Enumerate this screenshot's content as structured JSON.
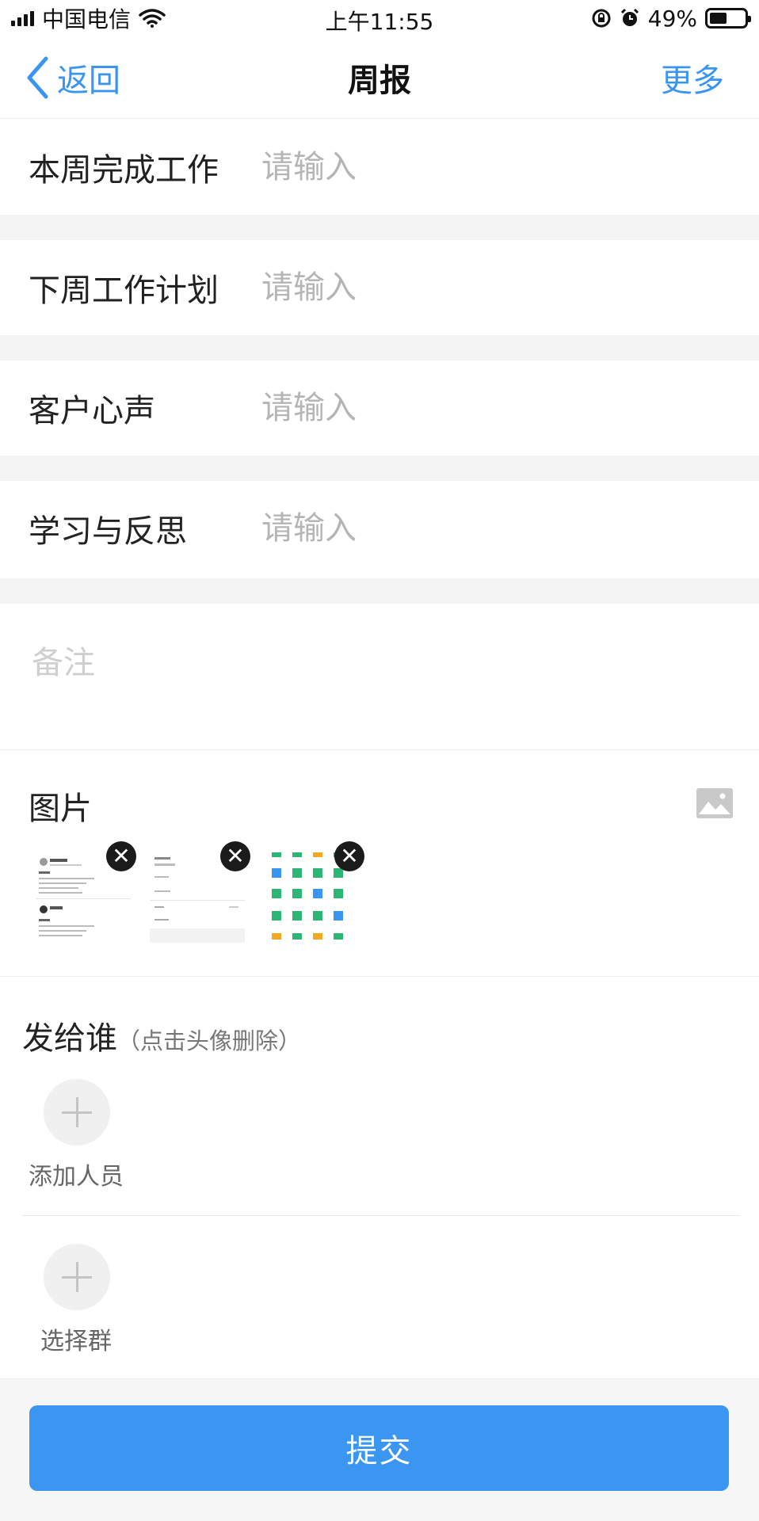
{
  "status_bar": {
    "carrier": "中国电信",
    "time": "上午11:55",
    "battery_percent": "49%",
    "battery_level": 0.49
  },
  "nav": {
    "back_label": "返回",
    "title": "周报",
    "more_label": "更多"
  },
  "form": {
    "rows": [
      {
        "label": "本周完成工作",
        "placeholder": "请输入"
      },
      {
        "label": "下周工作计划",
        "placeholder": "请输入"
      },
      {
        "label": "客户心声",
        "placeholder": "请输入"
      },
      {
        "label": "学习与反思",
        "placeholder": "请输入"
      }
    ],
    "remarks_placeholder": "备注"
  },
  "pictures": {
    "title": "图片",
    "thumbnails": [
      {
        "kind": "chat-screenshot"
      },
      {
        "kind": "form-screenshot"
      },
      {
        "kind": "icon-grid-screenshot"
      }
    ]
  },
  "send_to": {
    "title": "发给谁",
    "hint": "（点击头像删除）",
    "add_person_label": "添加人员",
    "select_group_label": "选择群"
  },
  "submit_label": "提交",
  "colors": {
    "accent": "#3a95f0",
    "submit": "#3a96f1",
    "placeholder": "#b5b5b5",
    "section_gap": "#f4f4f4"
  }
}
